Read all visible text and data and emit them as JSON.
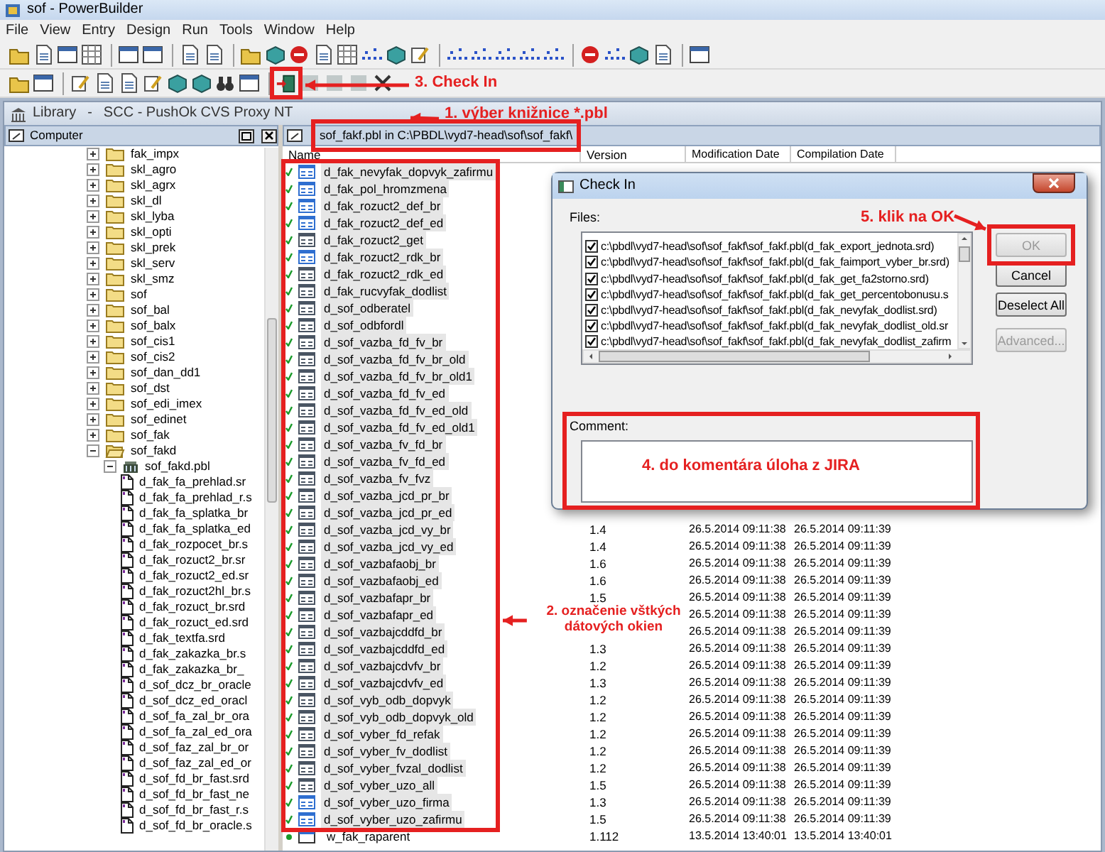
{
  "window": {
    "title": "sof - PowerBuilder"
  },
  "menu": [
    "File",
    "View",
    "Entry",
    "Design",
    "Run",
    "Tools",
    "Window",
    "Help"
  ],
  "library": {
    "title": "Library",
    "separator": "-",
    "scc": "SCC - PushOk CVS Proxy NT"
  },
  "tree_pane": {
    "title": "Computer"
  },
  "tree": [
    {
      "label": "fak_impx",
      "expanded": false
    },
    {
      "label": "skl_agro",
      "expanded": false
    },
    {
      "label": "skl_agrx",
      "expanded": false
    },
    {
      "label": "skl_dl",
      "expanded": false
    },
    {
      "label": "skl_lyba",
      "expanded": false
    },
    {
      "label": "skl_opti",
      "expanded": false
    },
    {
      "label": "skl_prek",
      "expanded": false
    },
    {
      "label": "skl_serv",
      "expanded": false
    },
    {
      "label": "skl_smz",
      "expanded": false
    },
    {
      "label": "sof",
      "expanded": false
    },
    {
      "label": "sof_bal",
      "expanded": false
    },
    {
      "label": "sof_balx",
      "expanded": false
    },
    {
      "label": "sof_cis1",
      "expanded": false
    },
    {
      "label": "sof_cis2",
      "expanded": false
    },
    {
      "label": "sof_dan_dd1",
      "expanded": false
    },
    {
      "label": "sof_dst",
      "expanded": false
    },
    {
      "label": "sof_edi_imex",
      "expanded": false
    },
    {
      "label": "sof_edinet",
      "expanded": false
    },
    {
      "label": "sof_fak",
      "expanded": false
    },
    {
      "label": "sof_fakd",
      "expanded": true,
      "children": [
        {
          "label": "sof_fakd.pbl",
          "expanded": true,
          "children": [
            {
              "label": "d_fak_fa_prehlad.sr"
            },
            {
              "label": "d_fak_fa_prehlad_r.s"
            },
            {
              "label": "d_fak_fa_splatka_br"
            },
            {
              "label": "d_fak_fa_splatka_ed"
            },
            {
              "label": "d_fak_rozpocet_br.s"
            },
            {
              "label": "d_fak_rozuct2_br.sr"
            },
            {
              "label": "d_fak_rozuct2_ed.sr"
            },
            {
              "label": "d_fak_rozuct2hl_br.s"
            },
            {
              "label": "d_fak_rozuct_br.srd"
            },
            {
              "label": "d_fak_rozuct_ed.srd"
            },
            {
              "label": "d_fak_textfa.srd"
            },
            {
              "label": "d_fak_zakazka_br.s"
            },
            {
              "label": "d_fak_zakazka_br_"
            },
            {
              "label": "d_sof_dcz_br_oracle"
            },
            {
              "label": "d_sof_dcz_ed_oracl"
            },
            {
              "label": "d_sof_fa_zal_br_ora"
            },
            {
              "label": "d_sof_fa_zal_ed_ora"
            },
            {
              "label": "d_sof_faz_zal_br_or"
            },
            {
              "label": "d_sof_faz_zal_ed_or"
            },
            {
              "label": "d_sof_fd_br_fast.srd"
            },
            {
              "label": "d_sof_fd_br_fast_ne"
            },
            {
              "label": "d_sof_fd_br_fast_r.s"
            },
            {
              "label": "d_sof_fd_br_oracle.s"
            }
          ]
        }
      ]
    }
  ],
  "list_pane": {
    "path": "sof_fakf.pbl in C:\\PBDL\\vyd7-head\\sof\\sof_fakf\\"
  },
  "columns": [
    "Name",
    "Version",
    "Modification Date",
    "Compilation Date"
  ],
  "rows": [
    {
      "name": "d_fak_nevyfak_dopvyk_zafirmu",
      "kind": "datawindow",
      "color": "#2f6fd0",
      "selected": true
    },
    {
      "name": "d_fak_pol_hromzmena",
      "kind": "datawindow",
      "color": "#2f6fd0",
      "selected": true
    },
    {
      "name": "d_fak_rozuct2_def_br",
      "kind": "datawindow",
      "color": "#2f6fd0",
      "selected": true
    },
    {
      "name": "d_fak_rozuct2_def_ed",
      "kind": "datawindow",
      "color": "#2f6fd0",
      "selected": true
    },
    {
      "name": "d_fak_rozuct2_get",
      "kind": "datawindow",
      "color": "#4a5563",
      "selected": true
    },
    {
      "name": "d_fak_rozuct2_rdk_br",
      "kind": "datawindow",
      "color": "#2f6fd0",
      "selected": true
    },
    {
      "name": "d_fak_rozuct2_rdk_ed",
      "kind": "datawindow",
      "color": "#4a5563",
      "selected": true
    },
    {
      "name": "d_fak_rucvyfak_dodlist",
      "kind": "datawindow",
      "color": "#4a5563",
      "selected": true
    },
    {
      "name": "d_sof_odberatel",
      "kind": "datawindow",
      "color": "#4a5563",
      "selected": true
    },
    {
      "name": "d_sof_odbfordl",
      "kind": "datawindow",
      "color": "#4a5563",
      "selected": true
    },
    {
      "name": "d_sof_vazba_fd_fv_br",
      "kind": "datawindow",
      "color": "#4a5563",
      "selected": true
    },
    {
      "name": "d_sof_vazba_fd_fv_br_old",
      "kind": "datawindow",
      "color": "#4a5563",
      "selected": true
    },
    {
      "name": "d_sof_vazba_fd_fv_br_old1",
      "kind": "datawindow",
      "color": "#4a5563",
      "selected": true
    },
    {
      "name": "d_sof_vazba_fd_fv_ed",
      "kind": "datawindow",
      "color": "#4a5563",
      "selected": true
    },
    {
      "name": "d_sof_vazba_fd_fv_ed_old",
      "kind": "datawindow",
      "color": "#4a5563",
      "selected": true
    },
    {
      "name": "d_sof_vazba_fd_fv_ed_old1",
      "kind": "datawindow",
      "color": "#4a5563",
      "selected": true
    },
    {
      "name": "d_sof_vazba_fv_fd_br",
      "kind": "datawindow",
      "color": "#4a5563",
      "selected": true
    },
    {
      "name": "d_sof_vazba_fv_fd_ed",
      "kind": "datawindow",
      "color": "#4a5563",
      "selected": true
    },
    {
      "name": "d_sof_vazba_fv_fvz",
      "kind": "datawindow",
      "color": "#4a5563",
      "selected": true
    },
    {
      "name": "d_sof_vazba_jcd_pr_br",
      "kind": "datawindow",
      "color": "#4a5563",
      "selected": true
    },
    {
      "name": "d_sof_vazba_jcd_pr_ed",
      "kind": "datawindow",
      "color": "#4a5563",
      "selected": true
    },
    {
      "name": "d_sof_vazba_jcd_vy_br",
      "kind": "datawindow",
      "color": "#4a5563",
      "selected": true,
      "version": "1.4",
      "modified": "26.5.2014 09:11:38",
      "compiled": "26.5.2014 09:11:39"
    },
    {
      "name": "d_sof_vazba_jcd_vy_ed",
      "kind": "datawindow",
      "color": "#4a5563",
      "selected": true,
      "version": "1.4",
      "modified": "26.5.2014 09:11:38",
      "compiled": "26.5.2014 09:11:39"
    },
    {
      "name": "d_sof_vazbafaobj_br",
      "kind": "datawindow",
      "color": "#4a5563",
      "selected": true,
      "version": "1.6",
      "modified": "26.5.2014 09:11:38",
      "compiled": "26.5.2014 09:11:39"
    },
    {
      "name": "d_sof_vazbafaobj_ed",
      "kind": "datawindow",
      "color": "#4a5563",
      "selected": true,
      "version": "1.6",
      "modified": "26.5.2014 09:11:38",
      "compiled": "26.5.2014 09:11:39"
    },
    {
      "name": "d_sof_vazbafapr_br",
      "kind": "datawindow",
      "color": "#4a5563",
      "selected": true,
      "version": "1.5",
      "modified": "26.5.2014 09:11:38",
      "compiled": "26.5.2014 09:11:39"
    },
    {
      "name": "d_sof_vazbafapr_ed",
      "kind": "datawindow",
      "color": "#4a5563",
      "selected": true,
      "modified": "26.5.2014 09:11:38",
      "compiled": "26.5.2014 09:11:39"
    },
    {
      "name": "d_sof_vazbajcddfd_br",
      "kind": "datawindow",
      "color": "#4a5563",
      "selected": true,
      "modified": "26.5.2014 09:11:38",
      "compiled": "26.5.2014 09:11:39"
    },
    {
      "name": "d_sof_vazbajcddfd_ed",
      "kind": "datawindow",
      "color": "#4a5563",
      "selected": true,
      "version": "1.3",
      "modified": "26.5.2014 09:11:38",
      "compiled": "26.5.2014 09:11:39"
    },
    {
      "name": "d_sof_vazbajcdvfv_br",
      "kind": "datawindow",
      "color": "#4a5563",
      "selected": true,
      "version": "1.2",
      "modified": "26.5.2014 09:11:38",
      "compiled": "26.5.2014 09:11:39"
    },
    {
      "name": "d_sof_vazbajcdvfv_ed",
      "kind": "datawindow",
      "color": "#4a5563",
      "selected": true,
      "version": "1.3",
      "modified": "26.5.2014 09:11:38",
      "compiled": "26.5.2014 09:11:39"
    },
    {
      "name": "d_sof_vyb_odb_dopvyk",
      "kind": "datawindow",
      "color": "#4a5563",
      "selected": true,
      "version": "1.2",
      "modified": "26.5.2014 09:11:38",
      "compiled": "26.5.2014 09:11:39"
    },
    {
      "name": "d_sof_vyb_odb_dopvyk_old",
      "kind": "datawindow",
      "color": "#4a5563",
      "selected": true,
      "version": "1.2",
      "modified": "26.5.2014 09:11:38",
      "compiled": "26.5.2014 09:11:39"
    },
    {
      "name": "d_sof_vyber_fd_refak",
      "kind": "datawindow",
      "color": "#4a5563",
      "selected": true,
      "version": "1.2",
      "modified": "26.5.2014 09:11:38",
      "compiled": "26.5.2014 09:11:39"
    },
    {
      "name": "d_sof_vyber_fv_dodlist",
      "kind": "datawindow",
      "color": "#4a5563",
      "selected": true,
      "version": "1.2",
      "modified": "26.5.2014 09:11:38",
      "compiled": "26.5.2014 09:11:39"
    },
    {
      "name": "d_sof_vyber_fvzal_dodlist",
      "kind": "datawindow",
      "color": "#4a5563",
      "selected": true,
      "version": "1.2",
      "modified": "26.5.2014 09:11:38",
      "compiled": "26.5.2014 09:11:39"
    },
    {
      "name": "d_sof_vyber_uzo_all",
      "kind": "datawindow",
      "color": "#4a5563",
      "selected": true,
      "version": "1.5",
      "modified": "26.5.2014 09:11:38",
      "compiled": "26.5.2014 09:11:39"
    },
    {
      "name": "d_sof_vyber_uzo_firma",
      "kind": "datawindow",
      "color": "#2f6fd0",
      "selected": true,
      "version": "1.3",
      "modified": "26.5.2014 09:11:38",
      "compiled": "26.5.2014 09:11:39"
    },
    {
      "name": "d_sof_vyber_uzo_zafirmu",
      "kind": "datawindow",
      "color": "#2f6fd0",
      "selected": true,
      "version": "1.5",
      "modified": "26.5.2014 09:11:38",
      "compiled": "26.5.2014 09:11:39"
    },
    {
      "name": "w_fak_raparent",
      "kind": "window",
      "color": "#2f6fd0",
      "selected": false,
      "version": "1.112",
      "modified": "13.5.2014 13:40:01",
      "compiled": "13.5.2014 13:40:01"
    }
  ],
  "dialog": {
    "title": "Check In",
    "files_label": "Files:",
    "files": [
      {
        "path": "c:\\pbdl\\vyd7-head\\sof\\sof_fakf\\sof_fakf.pbl(d_fak_export_jednota.srd)",
        "checked": true
      },
      {
        "path": "c:\\pbdl\\vyd7-head\\sof\\sof_fakf\\sof_fakf.pbl(d_fak_faimport_vyber_br.srd)",
        "checked": true
      },
      {
        "path": "c:\\pbdl\\vyd7-head\\sof\\sof_fakf\\sof_fakf.pbl(d_fak_get_fa2storno.srd)",
        "checked": true
      },
      {
        "path": "c:\\pbdl\\vyd7-head\\sof\\sof_fakf\\sof_fakf.pbl(d_fak_get_percentobonusu.s",
        "checked": true
      },
      {
        "path": "c:\\pbdl\\vyd7-head\\sof\\sof_fakf\\sof_fakf.pbl(d_fak_nevyfak_dodlist.srd)",
        "checked": true
      },
      {
        "path": "c:\\pbdl\\vyd7-head\\sof\\sof_fakf\\sof_fakf.pbl(d_fak_nevyfak_dodlist_old.sr",
        "checked": true
      },
      {
        "path": "c:\\pbdl\\vyd7-head\\sof\\sof_fakf\\sof_fakf.pbl(d_fak_nevyfak_dodlist_zafirm",
        "checked": true
      }
    ],
    "buttons": [
      {
        "label": "OK",
        "disabled": true
      },
      {
        "label": "Cancel",
        "disabled": false
      },
      {
        "label": "Deselect All",
        "disabled": false
      },
      {
        "label": "Advanced...",
        "disabled": true
      }
    ],
    "comment_label": "Comment:"
  },
  "annotations": [
    "1. výber knižnice *.pbl",
    "2. označenie vštkých dátových okien",
    "3. Check In",
    "4. do komentára úloha z JIRA",
    "5. klik na OK"
  ]
}
